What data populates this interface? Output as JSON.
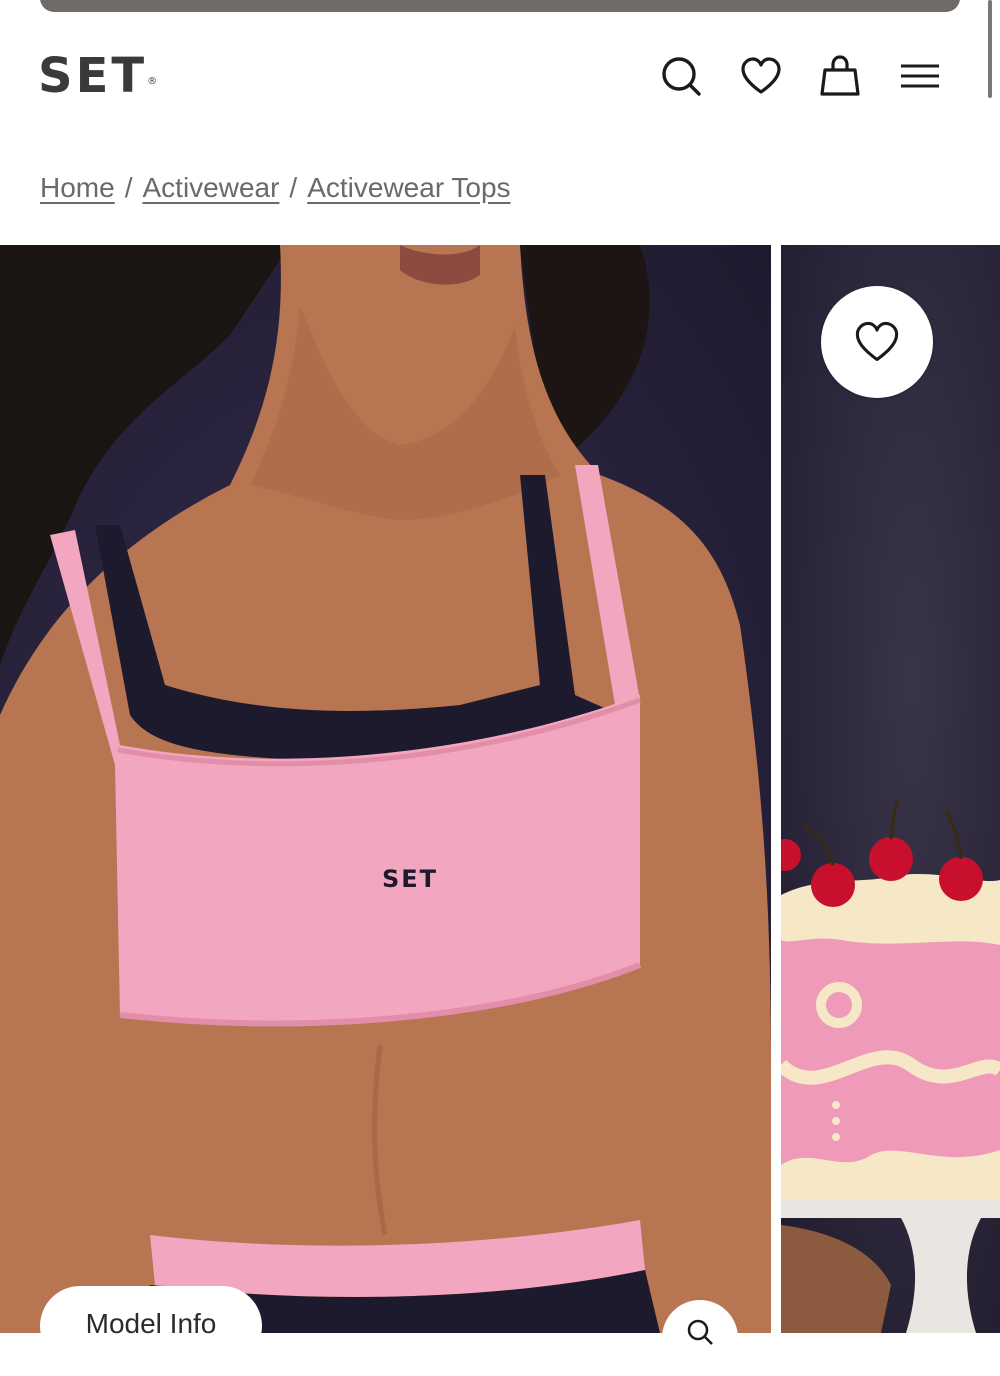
{
  "header": {
    "logo_text": "SET",
    "logo_mark": "®",
    "icons": [
      "search-icon",
      "heart-icon",
      "bag-icon",
      "menu-icon"
    ]
  },
  "breadcrumb": {
    "items": [
      "Home",
      "Activewear",
      "Activewear Tops"
    ],
    "separator": "/"
  },
  "gallery": {
    "model_info_label": "Model Info",
    "bra_logo_text": "SET",
    "colors": {
      "background": "#2b2540",
      "product_pink": "#f2a6bf",
      "product_navy": "#1c1a2c",
      "skin": "#b87552"
    }
  }
}
